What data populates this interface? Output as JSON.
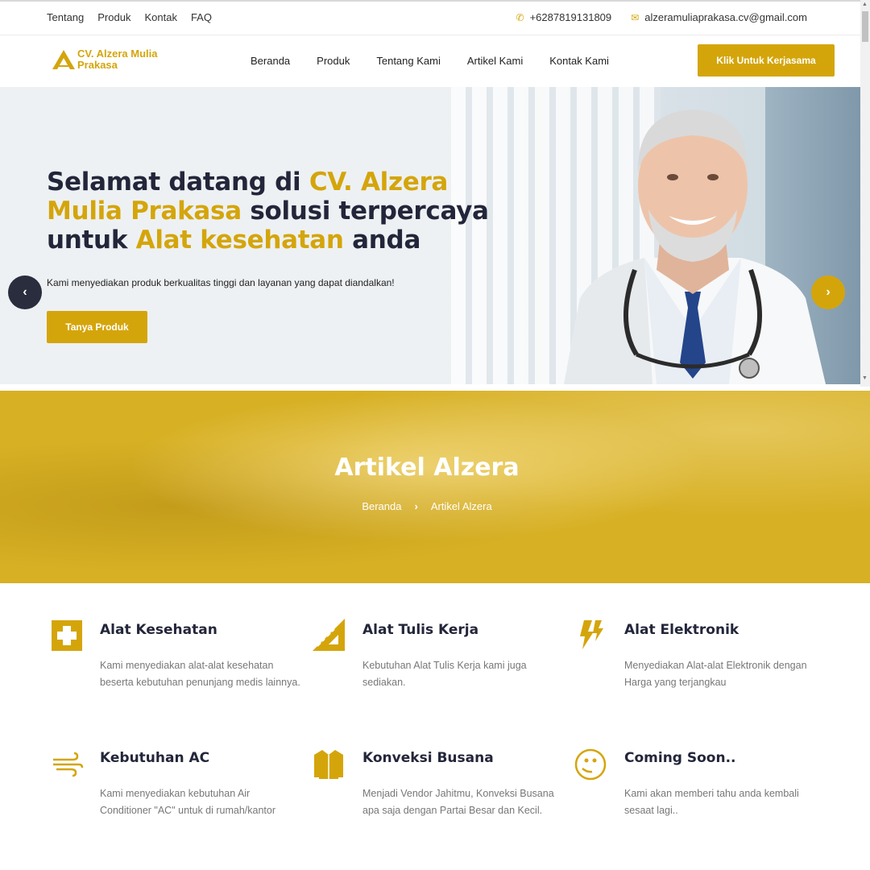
{
  "topbar": {
    "links": [
      "Tentang",
      "Produk",
      "Kontak",
      "FAQ"
    ],
    "phone": "+6287819131809",
    "email": "alzeramuliaprakasa.cv@gmail.com"
  },
  "nav": {
    "logo_text": "CV. Alzera Mulia Prakasa",
    "items": [
      "Beranda",
      "Produk",
      "Tentang Kami",
      "Artikel Kami",
      "Kontak Kami"
    ],
    "cta": "Klik Untuk Kerjasama"
  },
  "hero": {
    "title_1": "Selamat datang di ",
    "title_2": "CV. Alzera Mulia Prakasa",
    "title_3": " solusi terpercaya untuk ",
    "title_4": "Alat kesehatan",
    "title_5": " anda",
    "subtitle": "Kami menyediakan produk berkualitas tinggi dan layanan yang dapat diandalkan!",
    "button": "Tanya Produk"
  },
  "banner": {
    "title": "Artikel Alzera",
    "breadcrumb_home": "Beranda",
    "breadcrumb_current": "Artikel Alzera"
  },
  "services": [
    {
      "title": "Alat Kesehatan",
      "desc": "Kami menyediakan alat-alat kesehatan beserta kebutuhan penunjang medis lainnya.",
      "icon": "medical-cross-icon"
    },
    {
      "title": "Alat Tulis Kerja",
      "desc": "Kebutuhan Alat Tulis Kerja kami juga sediakan.",
      "icon": "ruler-triangle-icon"
    },
    {
      "title": "Alat Elektronik",
      "desc": "Menyediakan Alat-alat Elektronik dengan Harga yang terjangkau",
      "icon": "lightning-icon"
    },
    {
      "title": "Kebutuhan AC",
      "desc": "Kami menyediakan kebutuhan Air Conditioner \"AC\" untuk di rumah/kantor",
      "icon": "wind-icon"
    },
    {
      "title": "Konveksi Busana",
      "desc": "Menjadi Vendor Jahitmu, Konveksi Busana apa saja dengan Partai Besar dan Kecil.",
      "icon": "jacket-icon"
    },
    {
      "title": "Coming Soon..",
      "desc": "Kami akan memberi tahu anda kembali sesaat lagi..",
      "icon": "smiley-icon"
    }
  ],
  "colors": {
    "accent": "#d4a50b",
    "dark": "#23263a"
  }
}
